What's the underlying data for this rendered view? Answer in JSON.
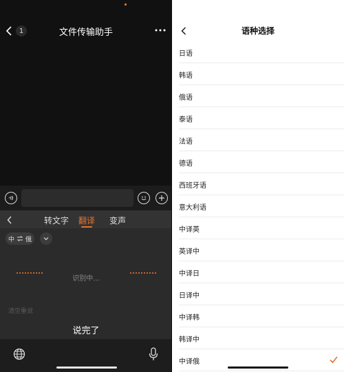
{
  "chat": {
    "title": "文件传输助手",
    "unread_badge": "1",
    "back_icon": "chevron-left-icon",
    "more_icon": "more-dots-icon"
  },
  "input_bar": {
    "voice_icon": "voice-icon",
    "emoji_icon": "emoji-icon",
    "add_icon": "plus-icon"
  },
  "voice_panel": {
    "tabs": [
      "转文字",
      "翻译",
      "变声"
    ],
    "active_tab": "翻译",
    "lang_from": "中",
    "lang_to": "俄",
    "status": "识别中...",
    "clear_label": "清空重说",
    "done_label": "说完了",
    "accent_color": "#e8722c"
  },
  "language_picker": {
    "title": "语种选择",
    "items": [
      "日语",
      "韩语",
      "俄语",
      "泰语",
      "法语",
      "德语",
      "西班牙语",
      "意大利语",
      "中译英",
      "英译中",
      "中译日",
      "日译中",
      "中译韩",
      "韩译中",
      "中译俄"
    ],
    "selected": "中译俄",
    "check_color": "#e8722c"
  }
}
